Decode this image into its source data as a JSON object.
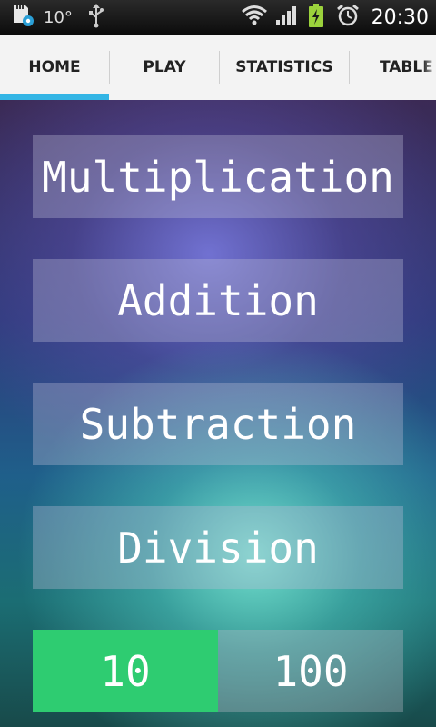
{
  "status_bar": {
    "temperature": "10°",
    "time": "20:30",
    "icons": [
      "sd-card-settings-icon",
      "usb-icon",
      "wifi-icon",
      "signal-icon",
      "battery-charging-icon",
      "alarm-icon"
    ]
  },
  "tabs": [
    {
      "label": "HOME",
      "selected": true
    },
    {
      "label": "PLAY",
      "selected": false
    },
    {
      "label": "STATISTICS",
      "selected": false
    },
    {
      "label": "TABLE",
      "selected": false
    }
  ],
  "operations": [
    {
      "label": "Multiplication"
    },
    {
      "label": "Addition"
    },
    {
      "label": "Subtraction"
    },
    {
      "label": "Division"
    }
  ],
  "range": {
    "options": [
      "10",
      "100"
    ],
    "selected": "10"
  },
  "colors": {
    "tab_indicator": "#33b5e5",
    "selected_range": "#2ecc71"
  }
}
